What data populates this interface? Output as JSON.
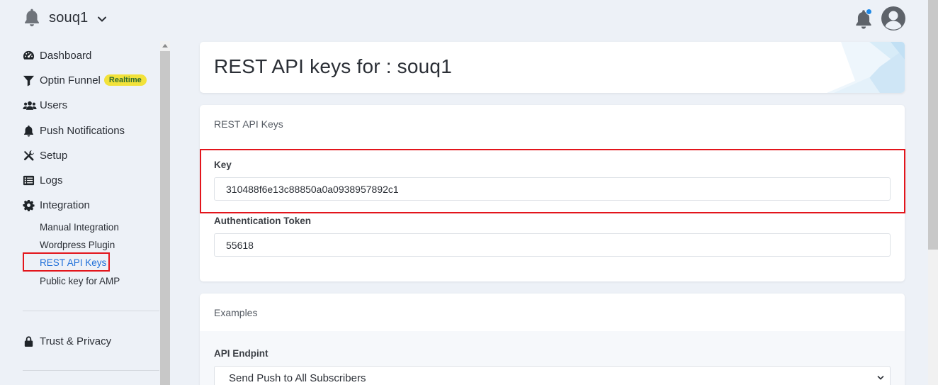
{
  "header": {
    "site_name": "souq1"
  },
  "sidebar": {
    "items": [
      {
        "label": "Dashboard",
        "icon": "dashboard-icon"
      },
      {
        "label": "Optin Funnel",
        "icon": "funnel-icon",
        "badge": "Realtime"
      },
      {
        "label": "Users",
        "icon": "users-icon"
      },
      {
        "label": "Push Notifications",
        "icon": "bell-icon"
      },
      {
        "label": "Setup",
        "icon": "tools-icon"
      },
      {
        "label": "Logs",
        "icon": "list-icon"
      },
      {
        "label": "Integration",
        "icon": "gear-icon"
      }
    ],
    "integration_sub": [
      {
        "label": "Manual Integration"
      },
      {
        "label": "Wordpress Plugin"
      },
      {
        "label": "REST API Keys",
        "active": true
      },
      {
        "label": "Public key for AMP"
      }
    ],
    "trust": {
      "label": "Trust & Privacy",
      "icon": "lock-icon"
    }
  },
  "page": {
    "title": "REST API keys for : souq1"
  },
  "keys_card": {
    "heading": "REST API Keys",
    "key_label": "Key",
    "key_value": "310488f6e13c88850a0a0938957892c1",
    "token_label": "Authentication Token",
    "token_value": "55618"
  },
  "examples_card": {
    "heading": "Examples",
    "endpoint_label": "API Endpint",
    "endpoint_selected": "Send Push to All Subscribers"
  },
  "colors": {
    "accent": "#1e6fd9",
    "highlight": "#e3151c",
    "badge_bg": "#f2e23a",
    "notification_dot": "#1e88e5",
    "background": "#edf1f7"
  }
}
